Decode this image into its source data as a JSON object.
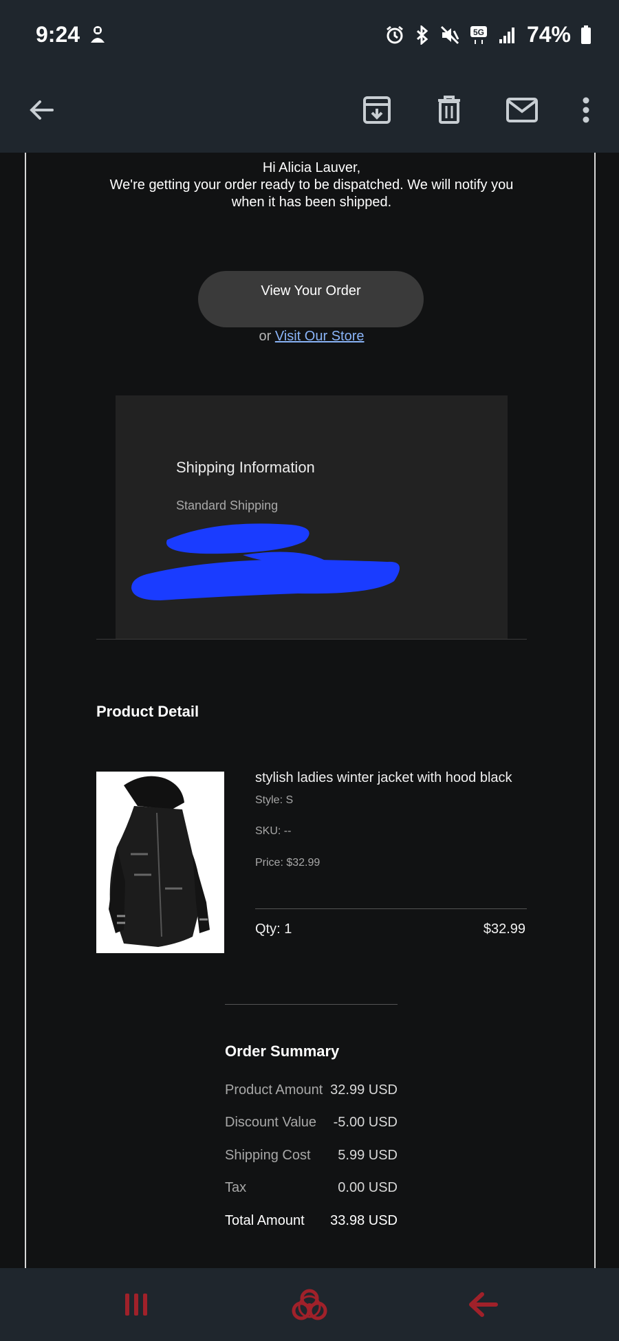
{
  "status_bar": {
    "time": "9:24",
    "battery": "74%",
    "network": "5G"
  },
  "app_bar": {
    "icons": [
      "back-arrow-icon",
      "archive-icon",
      "delete-icon",
      "mail-icon",
      "more-vert-icon"
    ]
  },
  "email": {
    "greeting": "Hi Alicia Lauver,",
    "message": "We're getting your order ready to be dispatched. We will notify you when it has been shipped.",
    "view_order_label": "View Your Order",
    "or_text": "or",
    "visit_store_label": "Visit Our Store",
    "shipping": {
      "title": "Shipping Information",
      "method": "Standard Shipping"
    },
    "product_detail": {
      "title": "Product Detail",
      "name": "stylish ladies winter jacket with hood black",
      "style": "Style: S",
      "sku": "SKU: --",
      "price": "Price: $32.99",
      "qty": "Qty: 1",
      "line_total": "$32.99"
    },
    "order_summary": {
      "title": "Order Summary",
      "rows": [
        {
          "label": "Product Amount",
          "value": "32.99 USD"
        },
        {
          "label": "Discount Value",
          "value": "-5.00 USD"
        },
        {
          "label": "Shipping Cost",
          "value": "5.99 USD"
        },
        {
          "label": "Tax",
          "value": "0.00 USD"
        },
        {
          "label": "Total Amount",
          "value": "33.98 USD"
        }
      ]
    }
  },
  "colors": {
    "bar_bg": "#1f262d",
    "content_bg": "#111213",
    "link": "#8ab4f8",
    "redaction": "#1a3cff",
    "nav_icon": "#c0392b"
  }
}
